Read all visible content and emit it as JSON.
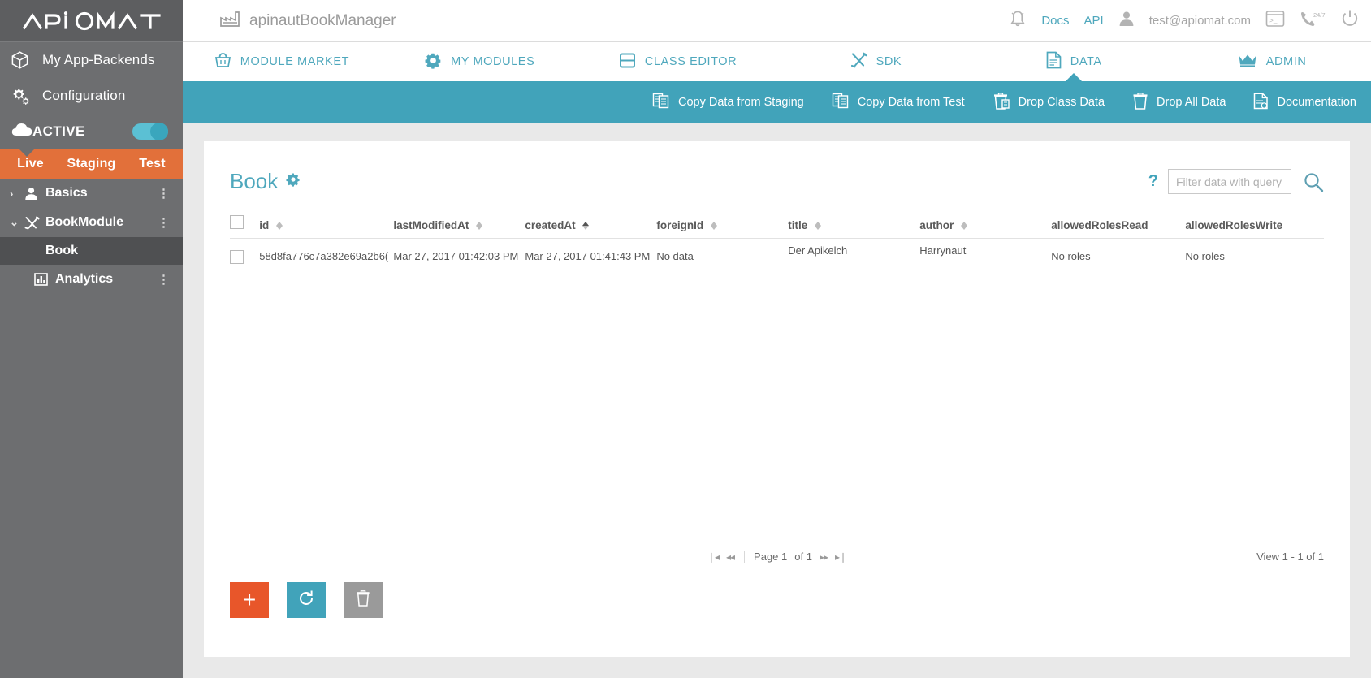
{
  "colors": {
    "accent_teal": "#41a3ba",
    "accent_teal_light": "#4fa8bd",
    "orange": "#e2703a",
    "orange_button": "#e8562a",
    "sidebar_gray": "#6d6e70",
    "sidebar_active": "#4f5052",
    "content_bg": "#e9e9e9"
  },
  "sidebar": {
    "logo_text": "APIOMAT",
    "items": [
      {
        "label": "My App-Backends",
        "icon": "cube-icon"
      },
      {
        "label": "Configuration",
        "icon": "gears-icon"
      }
    ],
    "active_row": {
      "label": "ACTIVE",
      "icon": "cloud-icon",
      "toggle_on": true
    },
    "environments": [
      {
        "label": "Live",
        "selected": true
      },
      {
        "label": "Staging",
        "selected": false
      },
      {
        "label": "Test",
        "selected": false
      }
    ],
    "tree": [
      {
        "label": "Basics",
        "icon": "person-icon",
        "caret": "›",
        "expanded": false,
        "kebab": "⋮"
      },
      {
        "label": "BookModule",
        "icon": "tools-icon",
        "caret": "⌄",
        "expanded": true,
        "kebab": "⋮"
      }
    ],
    "tree_child": {
      "label": "Book",
      "selected": true
    },
    "analytics": {
      "label": "Analytics",
      "icon": "bar-chart-icon",
      "kebab": "⋮"
    }
  },
  "topbar": {
    "app_icon": "factory-icon",
    "app_name": "apinautBookManager",
    "bell_icon": "bell-icon",
    "docs_label": "Docs",
    "api_label": "API",
    "user_icon": "person-icon",
    "user_email": "test@apiomat.com",
    "console_icon": "terminal-icon",
    "support_icon": "phone-24-7-icon",
    "support_badge": "24/7",
    "power_icon": "power-icon"
  },
  "nav": {
    "items": [
      {
        "label": "MODULE MARKET",
        "icon": "basket-icon",
        "active": false
      },
      {
        "label": "MY MODULES",
        "icon": "gear-icon",
        "active": false
      },
      {
        "label": "CLASS EDITOR",
        "icon": "class-editor-icon",
        "active": false
      },
      {
        "label": "SDK",
        "icon": "tools-icon",
        "active": false
      },
      {
        "label": "DATA",
        "icon": "document-icon",
        "active": true
      },
      {
        "label": "ADMIN",
        "icon": "crown-icon",
        "active": false
      }
    ]
  },
  "subbar": {
    "items": [
      {
        "label": "Copy Data from Staging",
        "icon": "copy-data-icon"
      },
      {
        "label": "Copy Data from Test",
        "icon": "copy-data-icon"
      },
      {
        "label": "Drop Class Data",
        "icon": "trash-class-icon"
      },
      {
        "label": "Drop All Data",
        "icon": "trash-icon"
      },
      {
        "label": "Documentation",
        "icon": "doc-icon"
      }
    ]
  },
  "card": {
    "title": "Book",
    "gear_icon": "gear-icon",
    "help_icon": "question-mark-icon",
    "search": {
      "placeholder": "Filter data with query",
      "value": "",
      "button_icon": "search-icon"
    }
  },
  "table": {
    "select_all_checked": false,
    "columns": [
      {
        "key": "id",
        "label": "id",
        "sortable": true,
        "sorted": "none"
      },
      {
        "key": "lastModifiedAt",
        "label": "lastModifiedAt",
        "sortable": true,
        "sorted": "none"
      },
      {
        "key": "createdAt",
        "label": "createdAt",
        "sortable": true,
        "sorted": "asc"
      },
      {
        "key": "foreignId",
        "label": "foreignId",
        "sortable": true,
        "sorted": "none"
      },
      {
        "key": "title",
        "label": "title",
        "sortable": true,
        "sorted": "none"
      },
      {
        "key": "author",
        "label": "author",
        "sortable": true,
        "sorted": "none"
      },
      {
        "key": "allowedRolesRead",
        "label": "allowedRolesRead",
        "sortable": false,
        "sorted": "none"
      },
      {
        "key": "allowedRolesWrite",
        "label": "allowedRolesWrite",
        "sortable": false,
        "sorted": "none"
      }
    ],
    "rows": [
      {
        "checked": false,
        "id": "58d8fa776c7a382e69a2b6(",
        "lastModifiedAt": "Mar 27, 2017 01:42:03 PM",
        "createdAt": "Mar 27, 2017 01:41:43 PM",
        "foreignId": "No data",
        "title": "Der Apikelch",
        "author": "Harrynaut",
        "allowedRolesRead": "No roles",
        "allowedRolesWrite": "No roles"
      }
    ]
  },
  "pagination": {
    "first_icon": "❘◂",
    "prev_icon": "◂◂",
    "page_label": "Page 1",
    "of_label": "of 1",
    "next_icon": "▸▸",
    "last_icon": "▸❘",
    "view_count": "View 1 - 1 of 1"
  },
  "actions": {
    "add": {
      "label": "+",
      "icon": "plus-icon"
    },
    "refresh": {
      "icon": "refresh-icon"
    },
    "delete": {
      "icon": "trash-icon"
    }
  }
}
